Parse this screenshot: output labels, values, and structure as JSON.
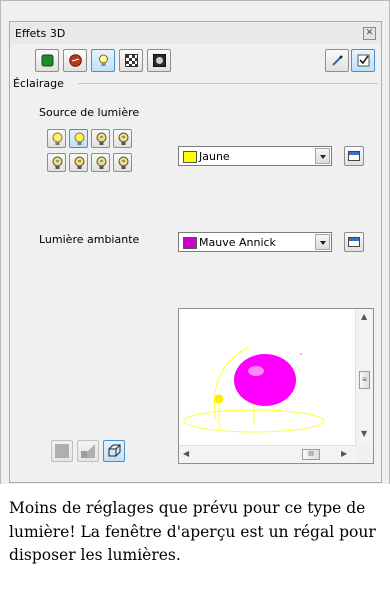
{
  "window": {
    "title": "Effets 3D",
    "close_glyph": "✕"
  },
  "toolbar": {
    "buttons": [
      {
        "name": "geometry-button",
        "icon": "green-cube-icon"
      },
      {
        "name": "shading-button",
        "icon": "shaded-sphere-icon"
      },
      {
        "name": "illumination-button",
        "icon": "light-bulb-icon",
        "selected": true
      },
      {
        "name": "textures-button",
        "icon": "checker-texture-icon"
      },
      {
        "name": "material-button",
        "icon": "material-icon"
      }
    ],
    "right_buttons": [
      {
        "name": "assign-button",
        "icon": "pipette-icon"
      },
      {
        "name": "update-button",
        "icon": "check-icon"
      }
    ]
  },
  "section": {
    "label": "Éclairage"
  },
  "light_source": {
    "label": "Source de lumière",
    "color_value": "Jaune",
    "swatch": "#ffff00"
  },
  "ambient": {
    "label": "Lumière ambiante",
    "color_value": "Mauve Annick",
    "swatch": "#cc00cc"
  },
  "preview": {
    "hscroll_glyph": "III",
    "vscroll_glyph": "≡"
  },
  "caption": "Moins de réglages que prévu pour ce type de lumière! La fenêtre d'aperçu est un régal pour disposer les lumières.",
  "colors": {
    "accent": "#4b8fd0",
    "sphere": "#ff00ff",
    "light": "#ffff00"
  }
}
